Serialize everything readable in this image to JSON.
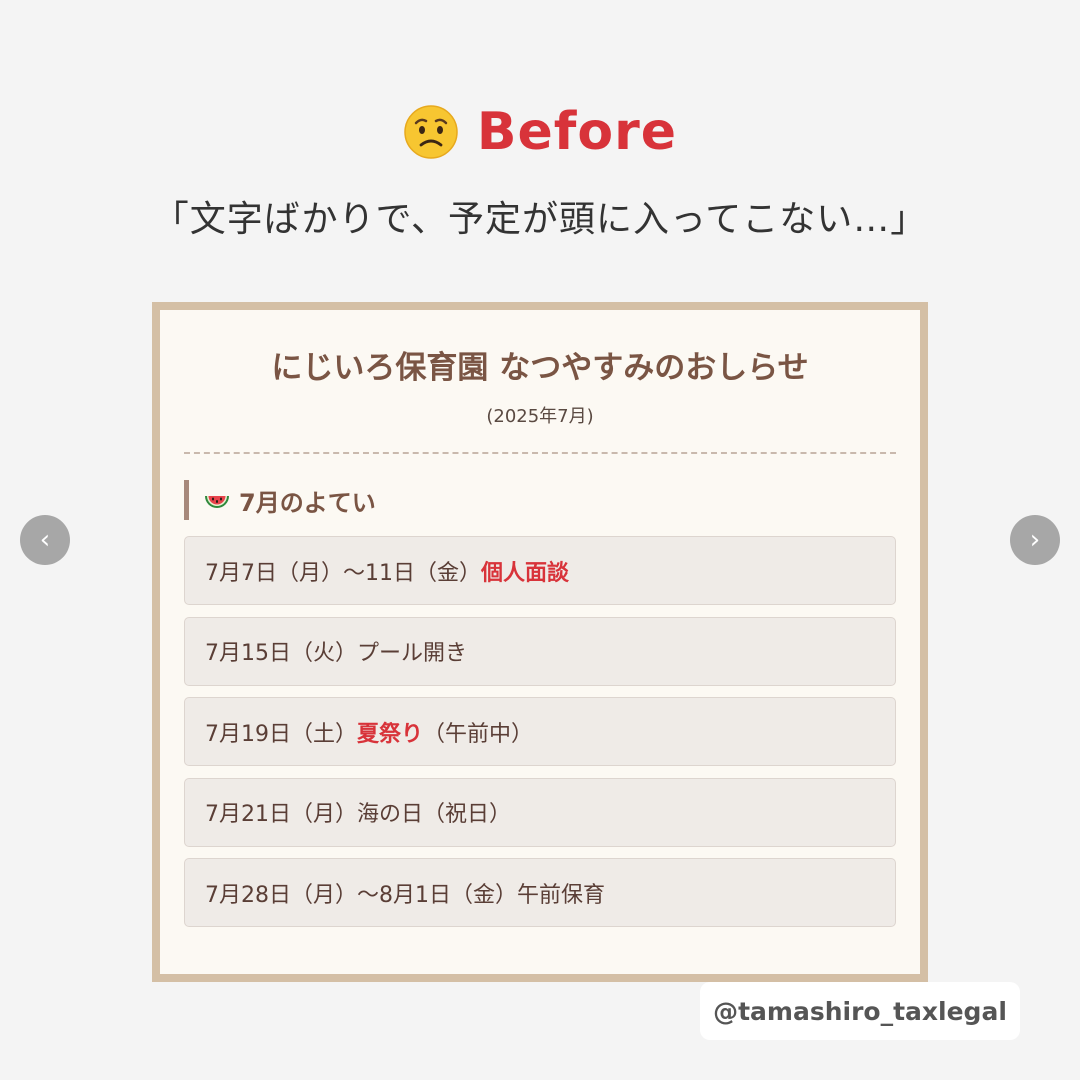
{
  "heading": {
    "icon": "worried-face-icon",
    "title": "Before"
  },
  "subtitle": "「文字ばかりで、予定が頭に入ってこない…」",
  "card": {
    "title": "にじいろ保育園 なつやすみのおしらせ",
    "date": "(2025年7月)",
    "section": {
      "icon": "watermelon-icon",
      "label": "7月のよてい"
    },
    "events": [
      {
        "text": "7月7日（月）～11日（金）",
        "highlight": "個人面談",
        "suffix": ""
      },
      {
        "text": "7月15日（火）プール開き",
        "highlight": "",
        "suffix": ""
      },
      {
        "text": "7月19日（土）",
        "highlight": "夏祭り",
        "suffix": "（午前中）"
      },
      {
        "text": "7月21日（月）海の日（祝日）",
        "highlight": "",
        "suffix": ""
      },
      {
        "text": "7月28日（月）～8月1日（金）午前保育",
        "highlight": "",
        "suffix": ""
      }
    ]
  },
  "nav": {
    "prev": "‹",
    "next": "›"
  },
  "handle": "@tamashiro_taxlegal",
  "colors": {
    "accent_red": "#d8333a",
    "brown_text": "#7a5544",
    "card_border": "#d4bfa5",
    "background": "#f4f4f4"
  }
}
